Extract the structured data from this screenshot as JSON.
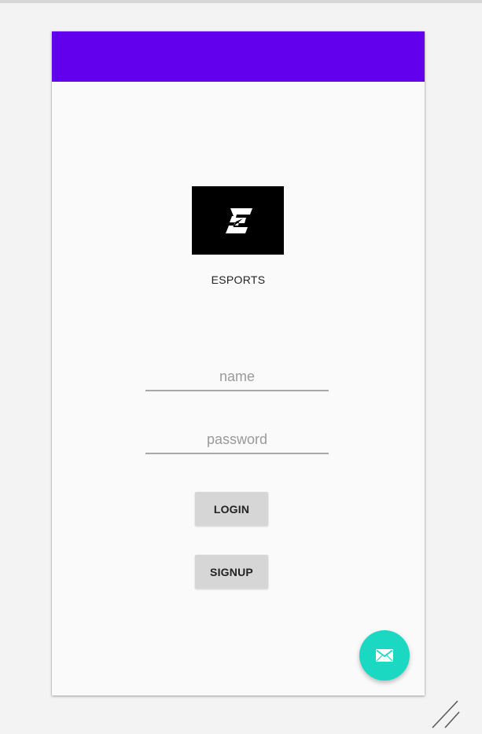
{
  "colors": {
    "app_bar": "#6200ee",
    "fab": "#1ad8c2",
    "logo_bg": "#000000",
    "logo_mark": "#ffffff"
  },
  "brand": {
    "logo_icon": "esports-logo-icon",
    "label": "ESPORTS"
  },
  "form": {
    "name_placeholder": "name",
    "password_placeholder": "password"
  },
  "buttons": {
    "login_label": "LOGIN",
    "signup_label": "SIGNUP"
  },
  "fab": {
    "icon": "mail-icon"
  }
}
